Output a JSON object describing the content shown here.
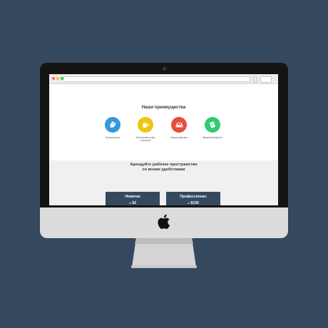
{
  "colors": {
    "background": "#34495e",
    "plan_card": "#34495e",
    "feature_blue": "#3498db",
    "feature_yellow": "#f1c40f",
    "feature_red": "#e74c3c",
    "feature_green": "#2ecc71"
  },
  "advantages": {
    "title": "Наши преимущества",
    "items": [
      {
        "label": "Лучшие цены",
        "icon": "price-tag-icon"
      },
      {
        "label_line1": "Бесплатные кофе",
        "label_line2": "и печенье",
        "icon": "coffee-cup-icon"
      },
      {
        "label": "Новая парковка",
        "icon": "car-icon"
      },
      {
        "label": "Фирменный фронт",
        "icon": "notebook-icon"
      }
    ]
  },
  "rent": {
    "title_line1": "Арендуйте рабочее пространство",
    "title_line2": "со всеми удобствами",
    "plans": [
      {
        "name": "Новичок",
        "price_prefix": "от",
        "price": "$2"
      },
      {
        "name": "Профессионал",
        "price_prefix": "от",
        "price": "$130"
      }
    ]
  }
}
